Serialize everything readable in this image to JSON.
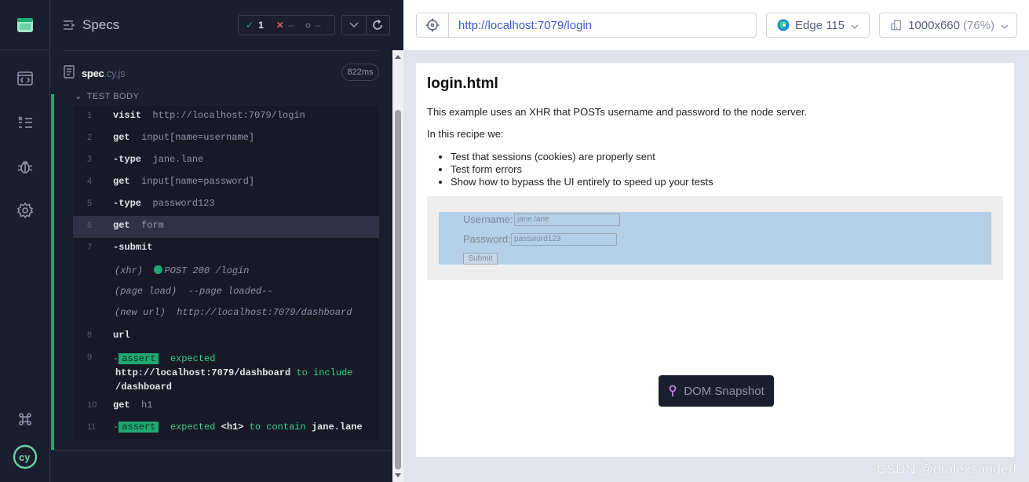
{
  "reporter": {
    "title": "Specs",
    "stats": {
      "passed": "1",
      "failed": "--",
      "pending": "--"
    },
    "spec": {
      "name": "spec",
      "ext": ".cy.js",
      "duration": "822ms"
    },
    "test_body_label": "TEST BODY",
    "commands": [
      {
        "num": "1",
        "name": "visit",
        "arg": "http://localhost:7079/login"
      },
      {
        "num": "2",
        "name": "get",
        "arg": "input[name=username]"
      },
      {
        "num": "3",
        "name": "-type",
        "arg": "jane.lane"
      },
      {
        "num": "4",
        "name": "get",
        "arg": "input[name=password]"
      },
      {
        "num": "5",
        "name": "-type",
        "arg": "password123"
      },
      {
        "num": "6",
        "name": "get",
        "arg": "form"
      },
      {
        "num": "7",
        "name": "-submit",
        "arg": ""
      }
    ],
    "events": [
      {
        "kind": "(xhr)",
        "text": "POST 200 /login"
      },
      {
        "kind": "(page load)",
        "text": "--page loaded--"
      },
      {
        "kind": "(new url)",
        "text": "http://localhost:7079/dashboard"
      }
    ],
    "cmd8": {
      "num": "8",
      "name": "url"
    },
    "cmd9": {
      "num": "9",
      "dash": "-",
      "badge": "assert",
      "expected": "expected",
      "url": "http://localhost:7079/dashboard",
      "to_include": "to include",
      "path": "/dashboard"
    },
    "cmd10": {
      "num": "10",
      "name": "get",
      "arg": "h1"
    },
    "cmd11": {
      "num": "11",
      "dash": "-",
      "badge": "assert",
      "expected": "expected",
      "h1": "<h1>",
      "to_contain": "to contain",
      "value": "jane.lane"
    }
  },
  "aut": {
    "url": "http://localhost:7079/login",
    "browser": "Edge 115",
    "viewport": "1000x660",
    "viewport_scale": "(76%)",
    "page": {
      "heading": "login.html",
      "intro": "This example uses an XHR that POSTs username and password to the node server.",
      "recipe": "In this recipe we:",
      "bullets": [
        "Test that sessions (cookies) are properly sent",
        "Test form errors",
        "Show how to bypass the UI entirely to speed up your tests"
      ],
      "form": {
        "username_label": "Username:",
        "username_value": "jane.lane",
        "password_label": "Password:",
        "password_value": "password123",
        "submit_label": "Submit"
      }
    },
    "snapshot_label": "DOM Snapshot"
  },
  "watermark": "CSDN @dralexsanderl",
  "colors": {
    "accent_green": "#1fa971",
    "url_blue": "#3a5ad1",
    "panel_dark": "#1b1e2e",
    "form_highlight": "#b4cfe8"
  }
}
